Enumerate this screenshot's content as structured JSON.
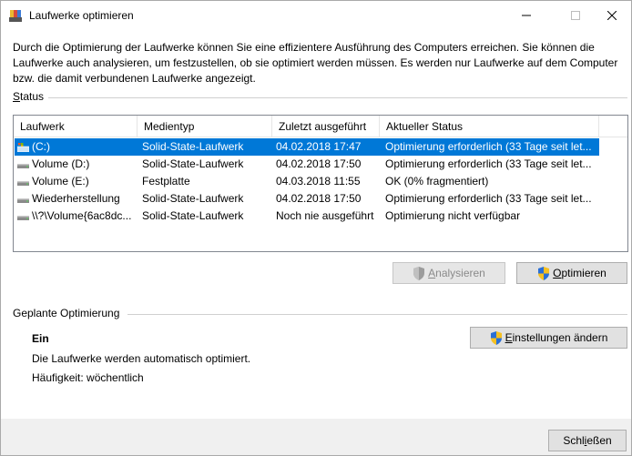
{
  "window": {
    "title": "Laufwerke optimieren",
    "controls": {
      "minimize": "minimize-icon",
      "maximize": "maximize-icon",
      "close": "close-icon"
    }
  },
  "intro_text": "Durch die Optimierung der Laufwerke können Sie eine effizientere Ausführung des Computers erreichen. Sie können die Laufwerke auch analysieren, um festzustellen, ob sie optimiert werden müssen. Es werden nur Laufwerke auf dem Computer bzw. die damit verbundenen Laufwerke angezeigt.",
  "status_section": {
    "label_prefix": "",
    "label_accel": "S",
    "label_rest": "tatus"
  },
  "table": {
    "columns": [
      "Laufwerk",
      "Medientyp",
      "Zuletzt ausgeführt",
      "Aktueller Status"
    ],
    "rows": [
      {
        "drive": "(C:)",
        "media": "Solid-State-Laufwerk",
        "last": "04.02.2018 17:47",
        "status": "Optimierung erforderlich (33 Tage seit let...",
        "icon": "system-drive-icon",
        "selected": true
      },
      {
        "drive": "Volume (D:)",
        "media": "Solid-State-Laufwerk",
        "last": "04.02.2018 17:50",
        "status": "Optimierung erforderlich (33 Tage seit let...",
        "icon": "drive-icon",
        "selected": false
      },
      {
        "drive": "Volume (E:)",
        "media": "Festplatte",
        "last": "04.03.2018 11:55",
        "status": "OK (0% fragmentiert)",
        "icon": "drive-icon",
        "selected": false
      },
      {
        "drive": "Wiederherstellung",
        "media": "Solid-State-Laufwerk",
        "last": "04.02.2018 17:50",
        "status": "Optimierung erforderlich (33 Tage seit let...",
        "icon": "drive-icon",
        "selected": false
      },
      {
        "drive": "\\\\?\\Volume{6ac8dc...",
        "media": "Solid-State-Laufwerk",
        "last": "Noch nie ausgeführt",
        "status": "Optimierung nicht verfügbar",
        "icon": "drive-icon",
        "selected": false
      }
    ]
  },
  "buttons": {
    "analyze": {
      "accel": "A",
      "rest": "nalysieren",
      "enabled": false
    },
    "optimize": {
      "accel": "O",
      "rest": "ptimieren",
      "enabled": true
    },
    "settings": {
      "accel": "E",
      "rest": "instellungen ändern",
      "enabled": true
    },
    "close": {
      "prefix": "Schl",
      "accel": "i",
      "rest": "eßen"
    }
  },
  "scheduled": {
    "label": "Geplante Optimierung",
    "state": "Ein",
    "description": "Die Laufwerke werden automatisch optimiert.",
    "frequency": "Häufigkeit: wöchentlich"
  },
  "colors": {
    "selection": "#0078d7",
    "footer": "#f0f0f0",
    "button": "#e1e1e1"
  }
}
